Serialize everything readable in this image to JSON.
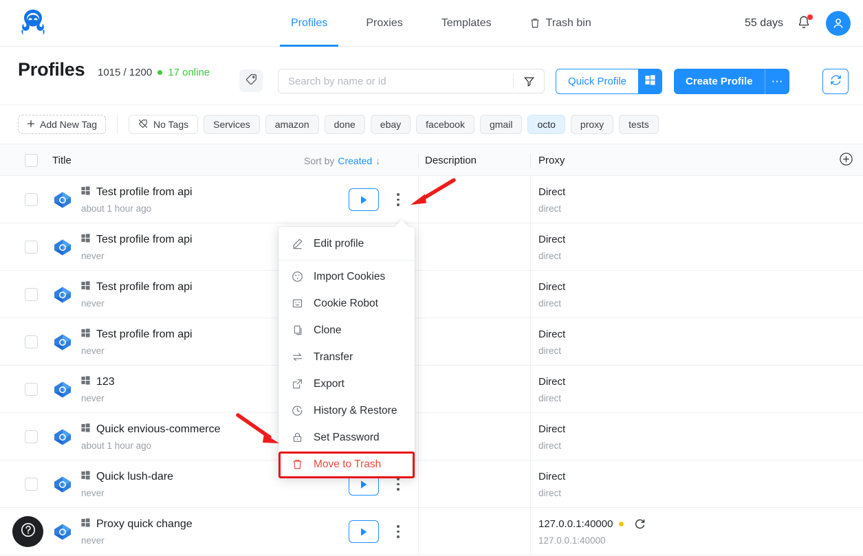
{
  "app": {
    "logo_name": "octo-browser-logo"
  },
  "topnav": {
    "links": [
      {
        "label": "Profiles",
        "active": true,
        "icon": null
      },
      {
        "label": "Proxies",
        "active": false,
        "icon": null
      },
      {
        "label": "Templates",
        "active": false,
        "icon": null
      },
      {
        "label": "Trash bin",
        "active": false,
        "icon": "trash-icon"
      }
    ],
    "days": "55 days",
    "bell_icon": "bell-icon",
    "bell_has_badge": true,
    "avatar_icon": "user-avatar-icon"
  },
  "page": {
    "title": "Profiles",
    "counts": "1015 / 1200",
    "online": "17 online",
    "tag_icon": "tag-icon"
  },
  "search": {
    "placeholder": "Search by name or id",
    "value": "",
    "filter_icon": "filter-funnel-icon"
  },
  "actions": {
    "quick_profile": "Quick Profile",
    "quick_profile_os_icon": "windows-icon",
    "create_profile": "Create Profile",
    "create_more": "⋯",
    "refresh_icon": "refresh-icon"
  },
  "tags": {
    "add_new": "Add New Tag",
    "no_tags": "No Tags",
    "items": [
      {
        "label": "Services",
        "selected": false
      },
      {
        "label": "amazon",
        "selected": false
      },
      {
        "label": "done",
        "selected": false
      },
      {
        "label": "ebay",
        "selected": false
      },
      {
        "label": "facebook",
        "selected": false
      },
      {
        "label": "gmail",
        "selected": false
      },
      {
        "label": "octo",
        "selected": true
      },
      {
        "label": "proxy",
        "selected": false
      },
      {
        "label": "tests",
        "selected": false
      }
    ]
  },
  "table": {
    "columns": {
      "title": "Title",
      "description": "Description",
      "proxy": "Proxy"
    },
    "sort": {
      "prefix": "Sort by",
      "field": "Created",
      "direction": "↓"
    },
    "add_column_icon": "plus-circle-icon",
    "rows": [
      {
        "title": "Test profile from api",
        "last_run": "about 1 hour ago",
        "os_icon": "windows-icon",
        "description": "",
        "proxy": "Direct",
        "proxy_sub": "direct",
        "proxy_status": null,
        "has_run": true,
        "has_reload": false
      },
      {
        "title": "Test profile from api",
        "last_run": "never",
        "os_icon": "windows-icon",
        "description": "",
        "proxy": "Direct",
        "proxy_sub": "direct",
        "proxy_status": null,
        "has_run": false,
        "has_reload": false
      },
      {
        "title": "Test profile from api",
        "last_run": "never",
        "os_icon": "windows-icon",
        "description": "",
        "proxy": "Direct",
        "proxy_sub": "direct",
        "proxy_status": null,
        "has_run": false,
        "has_reload": false
      },
      {
        "title": "Test profile from api",
        "last_run": "never",
        "os_icon": "windows-icon",
        "description": "",
        "proxy": "Direct",
        "proxy_sub": "direct",
        "proxy_status": null,
        "has_run": false,
        "has_reload": false
      },
      {
        "title": "123",
        "last_run": "never",
        "os_icon": "windows-icon",
        "description": "",
        "proxy": "Direct",
        "proxy_sub": "direct",
        "proxy_status": null,
        "has_run": false,
        "has_reload": false
      },
      {
        "title": "Quick envious-commerce",
        "last_run": "about 1 hour ago",
        "os_icon": "windows-icon",
        "description": "",
        "proxy": "Direct",
        "proxy_sub": "direct",
        "proxy_status": null,
        "has_run": false,
        "has_reload": false
      },
      {
        "title": "Quick lush-dare",
        "last_run": "never",
        "os_icon": "windows-icon",
        "description": "",
        "proxy": "Direct",
        "proxy_sub": "direct",
        "proxy_status": null,
        "has_run": true,
        "has_reload": false
      },
      {
        "title": "Proxy quick change",
        "last_run": "never",
        "os_icon": "windows-icon",
        "description": "",
        "proxy": "127.0.0.1:40000",
        "proxy_sub": "127.0.0.1:40000",
        "proxy_status": "#f5c518",
        "has_run": true,
        "has_reload": true
      }
    ]
  },
  "context_menu": {
    "items": [
      {
        "label": "Edit profile",
        "icon": "pencil-icon",
        "danger": false
      },
      {
        "label": "Import Cookies",
        "icon": "cookie-icon",
        "danger": false
      },
      {
        "label": "Cookie Robot",
        "icon": "robot-icon",
        "danger": false
      },
      {
        "label": "Clone",
        "icon": "copy-icon",
        "danger": false
      },
      {
        "label": "Transfer",
        "icon": "transfer-icon",
        "danger": false
      },
      {
        "label": "Export",
        "icon": "export-icon",
        "danger": false
      },
      {
        "label": "History & Restore",
        "icon": "history-icon",
        "danger": false
      },
      {
        "label": "Set Password",
        "icon": "lock-icon",
        "danger": false
      },
      {
        "label": "Move to Trash",
        "icon": "trash-icon",
        "danger": true
      }
    ]
  },
  "help": {
    "icon": "question-mark-icon"
  },
  "colors": {
    "accent": "#1f8fff",
    "danger": "#f0483e",
    "highlight_box": "#e8110f",
    "online_green": "#3dcb3d",
    "proxy_warning": "#f5c518",
    "chip_selected_bg": "#e3f2ff"
  }
}
